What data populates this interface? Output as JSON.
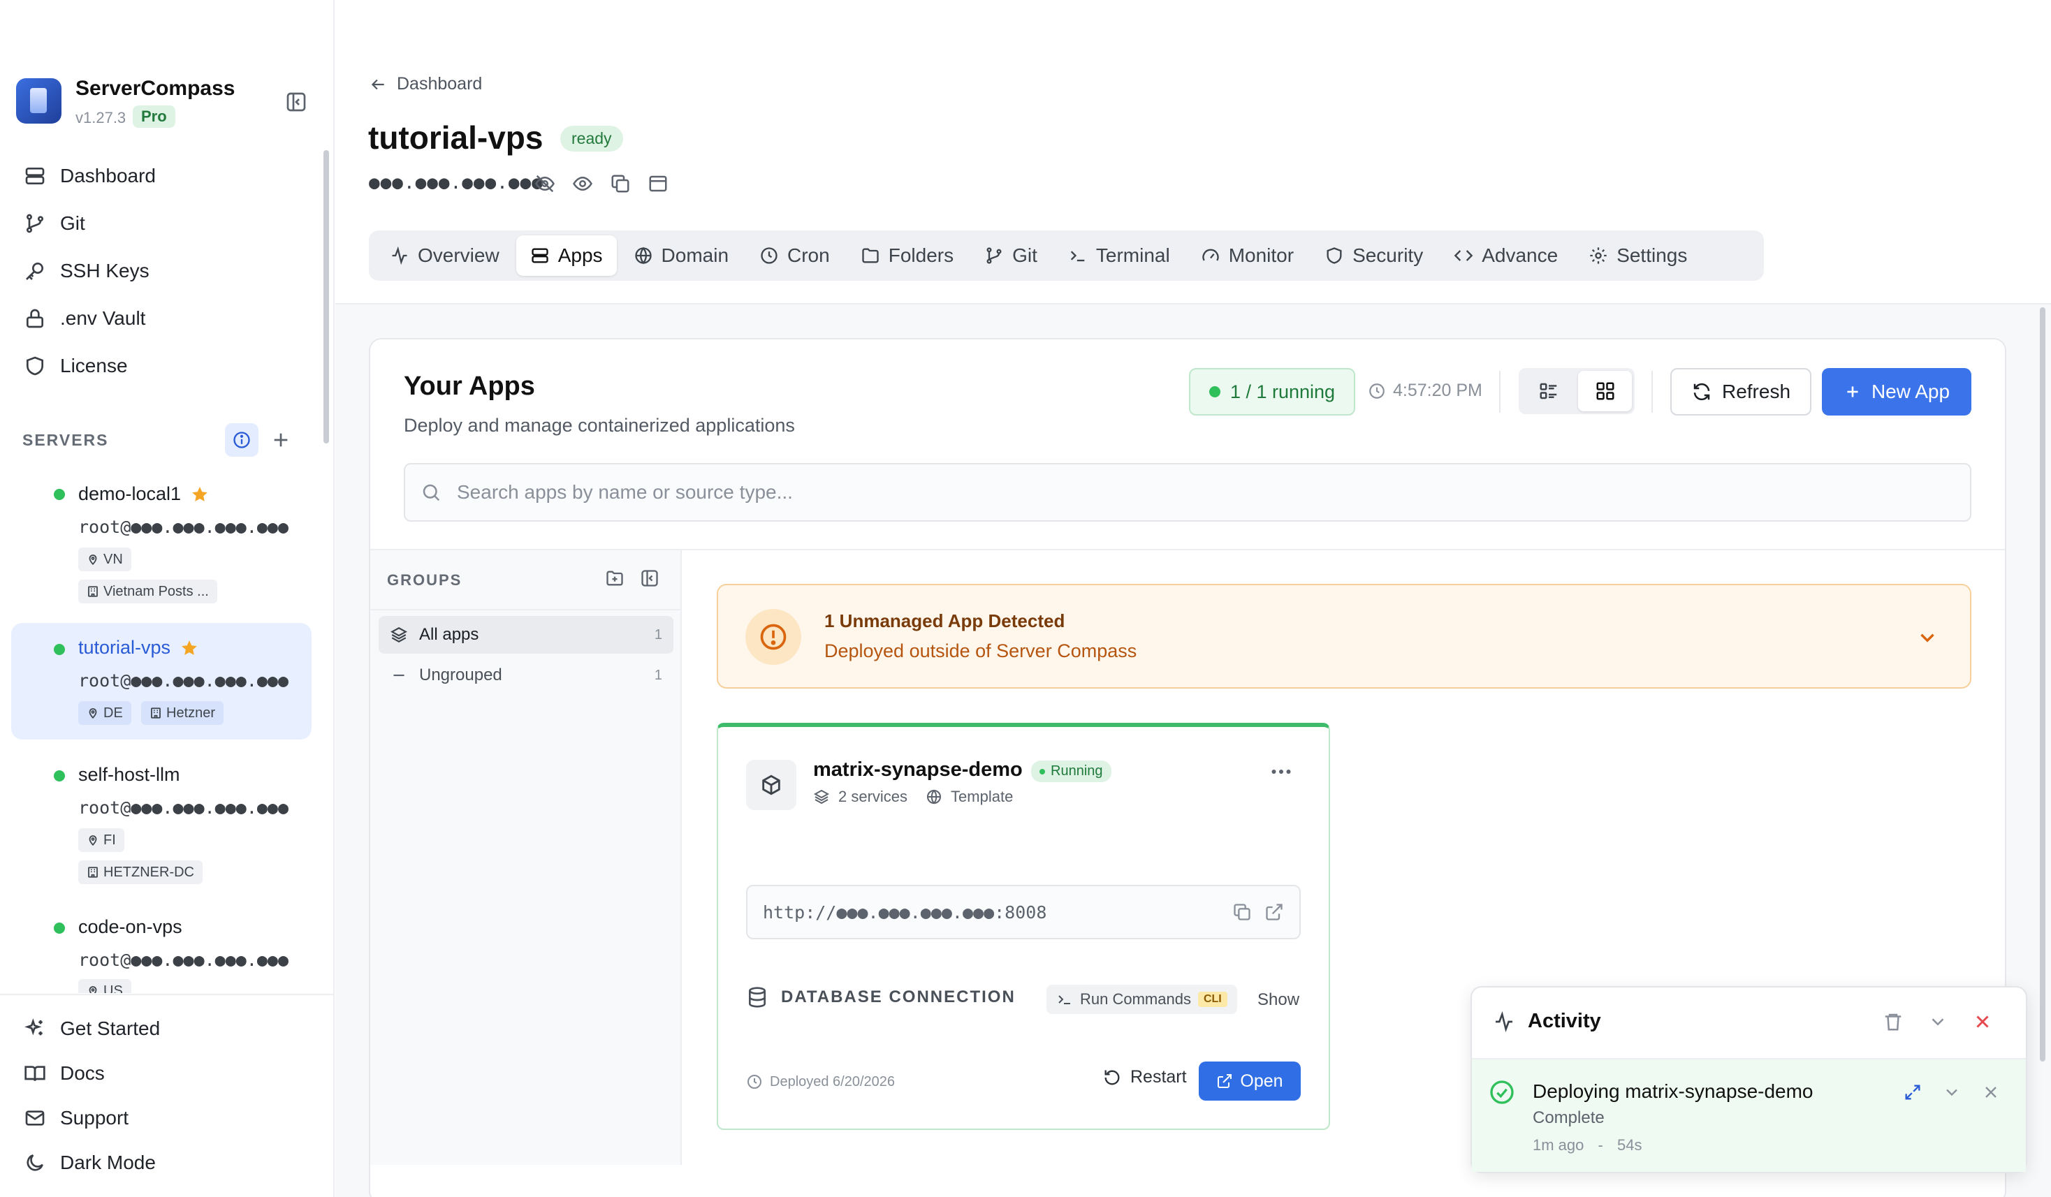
{
  "app": {
    "name": "ServerCompass",
    "version": "v1.27.3",
    "plan": "Pro"
  },
  "nav": {
    "items": [
      {
        "label": "Dashboard",
        "icon": "dashboard-icon"
      },
      {
        "label": "Git",
        "icon": "git-branch-icon"
      },
      {
        "label": "SSH Keys",
        "icon": "key-icon"
      },
      {
        "label": ".env Vault",
        "icon": "lock-icon"
      },
      {
        "label": "License",
        "icon": "shield-icon"
      }
    ],
    "bottom": [
      {
        "label": "Get Started",
        "icon": "sparkles-icon"
      },
      {
        "label": "Docs",
        "icon": "book-icon"
      },
      {
        "label": "Support",
        "icon": "mail-icon"
      },
      {
        "label": "Dark Mode",
        "icon": "moon-icon"
      }
    ]
  },
  "servers": {
    "label": "SERVERS",
    "items": [
      {
        "name": "demo-local1",
        "host": "root@●●●.●●●.●●●.●●●",
        "country": "VN",
        "provider": "Vietnam Posts ...",
        "starred": true,
        "active": false
      },
      {
        "name": "tutorial-vps",
        "host": "root@●●●.●●●.●●●.●●●",
        "country": "DE",
        "provider": "Hetzner",
        "starred": true,
        "active": true
      },
      {
        "name": "self-host-llm",
        "host": "root@●●●.●●●.●●●.●●●",
        "country": "FI",
        "provider": "HETZNER-DC",
        "starred": false,
        "active": false
      },
      {
        "name": "code-on-vps",
        "host": "root@●●●.●●●.●●●.●●●",
        "country": "US",
        "provider": "",
        "starred": false,
        "active": false
      }
    ]
  },
  "header": {
    "breadcrumb": "Dashboard",
    "title": "tutorial-vps",
    "status": "ready",
    "masked_ip": "●●●.●●●.●●●.●●●"
  },
  "tabs": [
    {
      "label": "Overview",
      "icon": "activity-icon",
      "active": false
    },
    {
      "label": "Apps",
      "icon": "server-stack-icon",
      "active": true
    },
    {
      "label": "Domain",
      "icon": "globe-icon",
      "active": false
    },
    {
      "label": "Cron",
      "icon": "clock-icon",
      "active": false
    },
    {
      "label": "Folders",
      "icon": "folder-icon",
      "active": false
    },
    {
      "label": "Git",
      "icon": "git-branch-icon",
      "active": false
    },
    {
      "label": "Terminal",
      "icon": "terminal-icon",
      "active": false
    },
    {
      "label": "Monitor",
      "icon": "gauge-icon",
      "active": false
    },
    {
      "label": "Security",
      "icon": "shield-icon",
      "active": false
    },
    {
      "label": "Advance",
      "icon": "code-icon",
      "active": false
    },
    {
      "label": "Settings",
      "icon": "gear-icon",
      "active": false
    }
  ],
  "apps": {
    "title": "Your Apps",
    "subtitle": "Deploy and manage containerized applications",
    "running": "1 / 1 running",
    "time": "4:57:20 PM",
    "refresh_label": "Refresh",
    "new_app_label": "New App",
    "search_placeholder": "Search apps by name or source type..."
  },
  "groups": {
    "label": "GROUPS",
    "items": [
      {
        "label": "All apps",
        "count": "1",
        "active": true
      },
      {
        "label": "Ungrouped",
        "count": "1",
        "active": false
      }
    ]
  },
  "banner": {
    "title": "1 Unmanaged App Detected",
    "subtitle": "Deployed outside of Server Compass"
  },
  "app_card": {
    "name": "matrix-synapse-demo",
    "status": "Running",
    "services": "2 services",
    "source": "Template",
    "url": "http://●●●.●●●.●●●.●●●:8008",
    "db_label": "DATABASE CONNECTION",
    "run_commands": "Run Commands",
    "cli": "CLI",
    "show": "Show",
    "deployed": "Deployed 6/20/2026",
    "restart": "Restart",
    "open": "Open"
  },
  "activity": {
    "title": "Activity",
    "item_title": "Deploying matrix-synapse-demo",
    "item_status": "Complete",
    "item_time": "1m ago",
    "item_duration": "54s"
  },
  "colors": {
    "accent": "#3b74ea",
    "success": "#2fbf5b",
    "warning": "#f7cf9a",
    "star": "#f5a524"
  }
}
